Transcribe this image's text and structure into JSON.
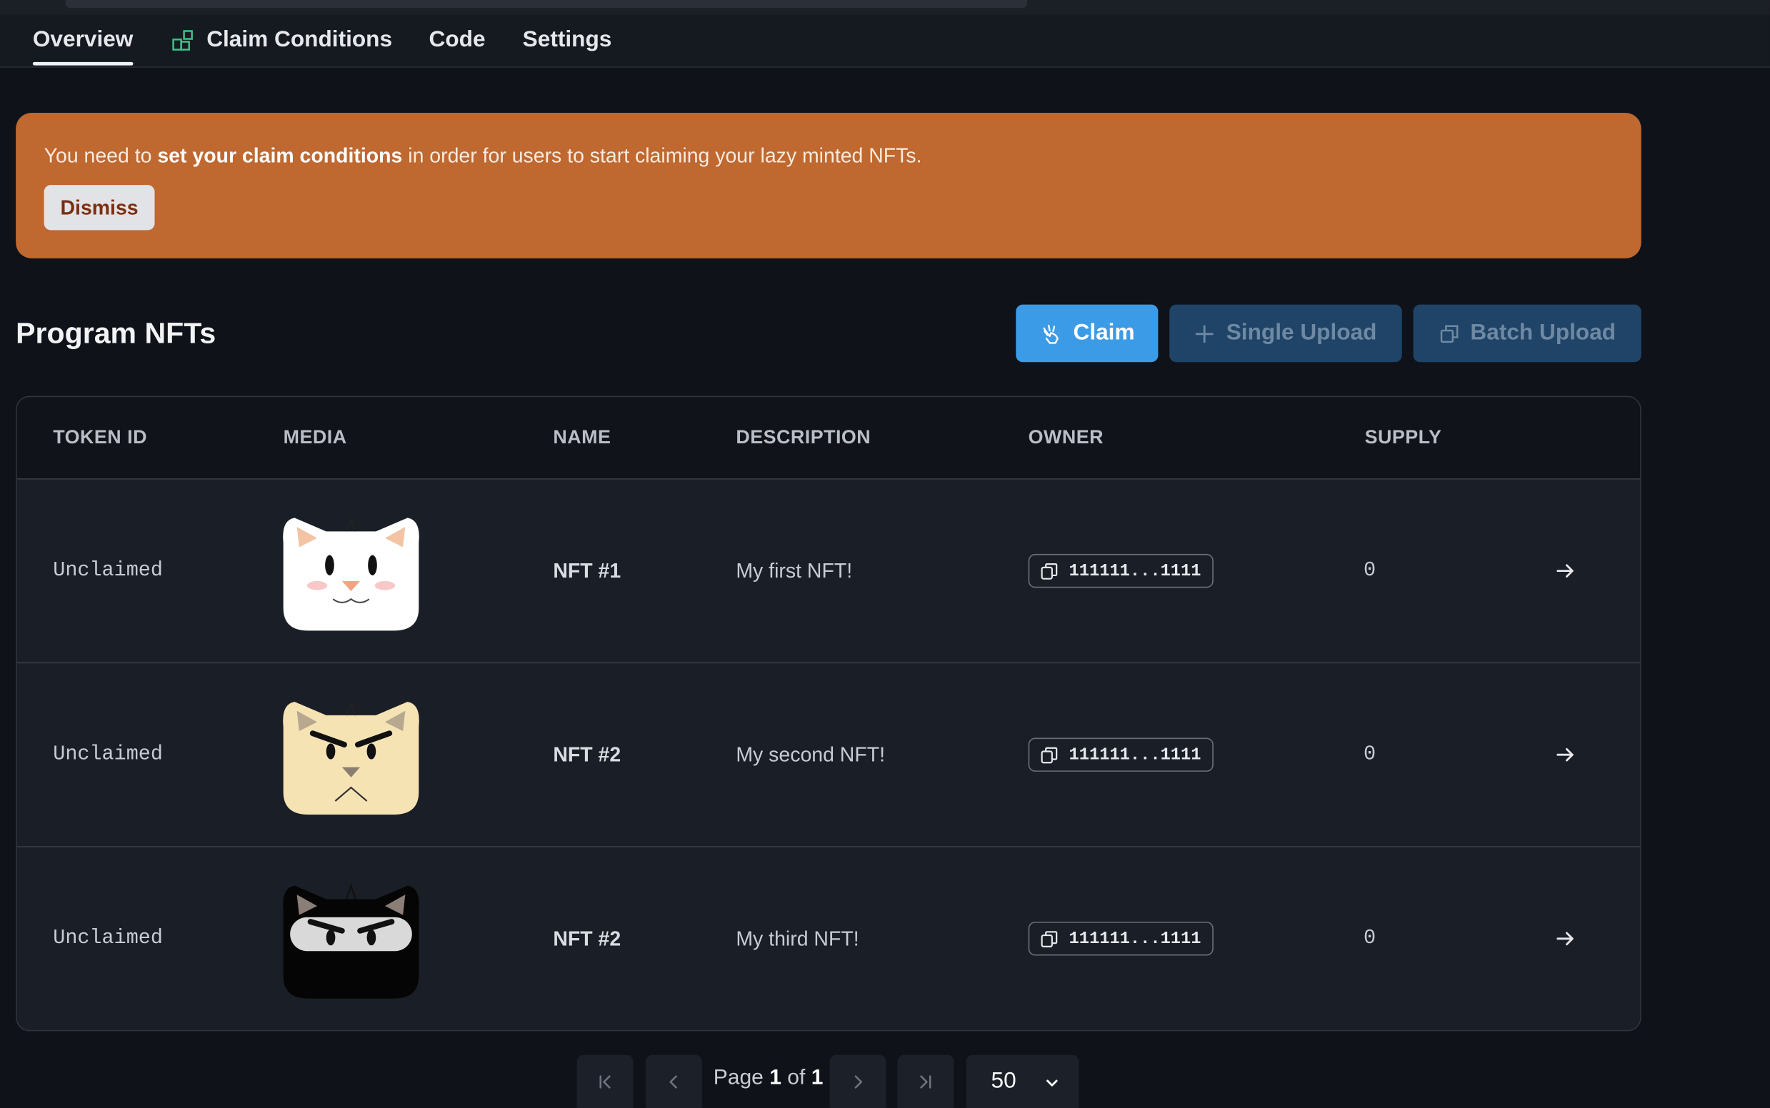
{
  "tabs": [
    {
      "label": "Overview"
    },
    {
      "label": "Claim Conditions"
    },
    {
      "label": "Code"
    },
    {
      "label": "Settings"
    }
  ],
  "banner": {
    "text_before": "You need to ",
    "text_bold": "set your claim conditions",
    "text_after": " in order for users to start claiming your lazy minted NFTs.",
    "dismiss_label": "Dismiss",
    "color": "#bf6830"
  },
  "section": {
    "title": "Program NFTs",
    "claim_label": "Claim",
    "single_upload_label": "Single Upload",
    "batch_upload_label": "Batch Upload"
  },
  "table": {
    "headers": [
      "TOKEN ID",
      "MEDIA",
      "NAME",
      "DESCRIPTION",
      "OWNER",
      "SUPPLY"
    ],
    "rows": [
      {
        "token_id": "Unclaimed",
        "media": "white-cat",
        "name": "NFT #1",
        "description": "My first NFT!",
        "owner": "111111...1111",
        "supply": "0"
      },
      {
        "token_id": "Unclaimed",
        "media": "cream-cat",
        "name": "NFT #2",
        "description": "My second NFT!",
        "owner": "111111...1111",
        "supply": "0"
      },
      {
        "token_id": "Unclaimed",
        "media": "ninja-cat",
        "name": "NFT #2",
        "description": "My third NFT!",
        "owner": "111111...1111",
        "supply": "0"
      }
    ]
  },
  "pagination": {
    "page_word": "Page",
    "current": "1",
    "of_word": "of",
    "total": "1",
    "page_size": "50"
  },
  "colors": {
    "accent": "#3c9be6",
    "background": "#0f1218"
  }
}
